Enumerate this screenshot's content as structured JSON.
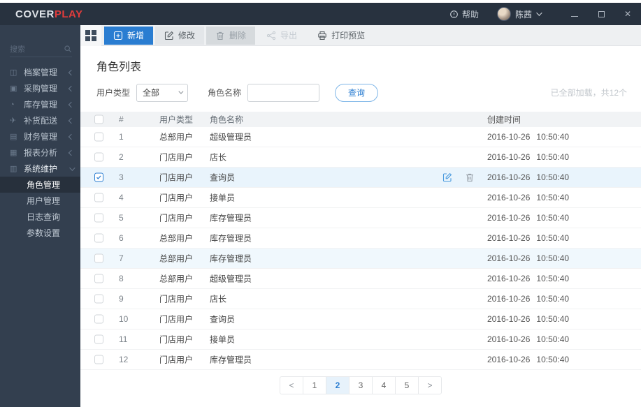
{
  "colors": {
    "accent_blue": "#2a7dd1",
    "brand_red": "#e23c3c",
    "topbar_bg": "#28323f",
    "sidebar_bg": "#333f4f",
    "selected_row_bg": "#e9f4fc"
  },
  "topbar": {
    "logo_primary": "COVER",
    "logo_accent": "PLAY",
    "help_label": "帮助",
    "user_name": "陈茜",
    "window_controls": [
      "minimize",
      "maximize",
      "close"
    ]
  },
  "sidebar": {
    "search_placeholder": "搜索",
    "items": [
      {
        "key": "archives",
        "label": "档案管理",
        "icon": "archive-icon",
        "glyph": "◫"
      },
      {
        "key": "purchase",
        "label": "采购管理",
        "icon": "purchase-icon",
        "glyph": "▣"
      },
      {
        "key": "inventory",
        "label": "库存管理",
        "icon": "inventory-icon",
        "glyph": "◔"
      },
      {
        "key": "replenish",
        "label": "补货配送",
        "icon": "delivery-icon",
        "glyph": "✈"
      },
      {
        "key": "finance",
        "label": "财务管理",
        "icon": "finance-icon",
        "glyph": "▤"
      },
      {
        "key": "reports",
        "label": "报表分析",
        "icon": "report-icon",
        "glyph": "▦"
      },
      {
        "key": "system",
        "label": "系统维护",
        "icon": "system-icon",
        "glyph": "▥",
        "expanded": true
      }
    ],
    "subitems": [
      {
        "key": "roles",
        "label": "角色管理",
        "active": true
      },
      {
        "key": "users",
        "label": "用户管理"
      },
      {
        "key": "logs",
        "label": "日志查询"
      },
      {
        "key": "params",
        "label": "参数设置"
      }
    ]
  },
  "toolbar": {
    "buttons": [
      {
        "key": "add",
        "label": "新增",
        "icon": "plus-square-icon",
        "style": "primary"
      },
      {
        "key": "edit",
        "label": "修改",
        "icon": "pencil-icon",
        "style": "normal"
      },
      {
        "key": "delete",
        "label": "删除",
        "icon": "trash-icon",
        "style": "muted"
      },
      {
        "key": "export",
        "label": "导出",
        "icon": "share-icon",
        "style": "disabled"
      },
      {
        "key": "print-preview",
        "label": "打印预览",
        "icon": "printer-icon",
        "style": "plain"
      }
    ]
  },
  "main": {
    "page_title": "角色列表",
    "filters": {
      "user_type_label": "用户类型",
      "user_type_value": "全部",
      "role_name_label": "角色名称",
      "role_name_value": "",
      "query_button_label": "查询"
    },
    "load_status": "已全部加载，共12个",
    "table": {
      "columns": [
        "#",
        "用户类型",
        "角色名称",
        "创建时间"
      ],
      "rows": [
        {
          "index": "1",
          "user_type": "总部用户",
          "role_name": "超级管理员",
          "date": "2016-10-26",
          "time": "10:50:40"
        },
        {
          "index": "2",
          "user_type": "门店用户",
          "role_name": "店长",
          "date": "2016-10-26",
          "time": "10:50:40"
        },
        {
          "index": "3",
          "user_type": "门店用户",
          "role_name": "查询员",
          "date": "2016-10-26",
          "time": "10:50:40",
          "checked": true,
          "selected": true,
          "actions": true
        },
        {
          "index": "4",
          "user_type": "门店用户",
          "role_name": "接单员",
          "date": "2016-10-26",
          "time": "10:50:40"
        },
        {
          "index": "5",
          "user_type": "门店用户",
          "role_name": "库存管理员",
          "date": "2016-10-26",
          "time": "10:50:40"
        },
        {
          "index": "6",
          "user_type": "总部用户",
          "role_name": "库存管理员",
          "date": "2016-10-26",
          "time": "10:50:40"
        },
        {
          "index": "7",
          "user_type": "总部用户",
          "role_name": "库存管理员",
          "date": "2016-10-26",
          "time": "10:50:40",
          "hovered": true
        },
        {
          "index": "8",
          "user_type": "总部用户",
          "role_name": "超级管理员",
          "date": "2016-10-26",
          "time": "10:50:40"
        },
        {
          "index": "9",
          "user_type": "门店用户",
          "role_name": "店长",
          "date": "2016-10-26",
          "time": "10:50:40"
        },
        {
          "index": "10",
          "user_type": "门店用户",
          "role_name": "查询员",
          "date": "2016-10-26",
          "time": "10:50:40"
        },
        {
          "index": "11",
          "user_type": "门店用户",
          "role_name": "接单员",
          "date": "2016-10-26",
          "time": "10:50:40"
        },
        {
          "index": "12",
          "user_type": "门店用户",
          "role_name": "库存管理员",
          "date": "2016-10-26",
          "time": "10:50:40"
        }
      ]
    },
    "pagination": {
      "prev_label": "<",
      "pages": [
        "1",
        "2",
        "3",
        "4",
        "5"
      ],
      "active_page": "2",
      "next_label": ">"
    }
  }
}
